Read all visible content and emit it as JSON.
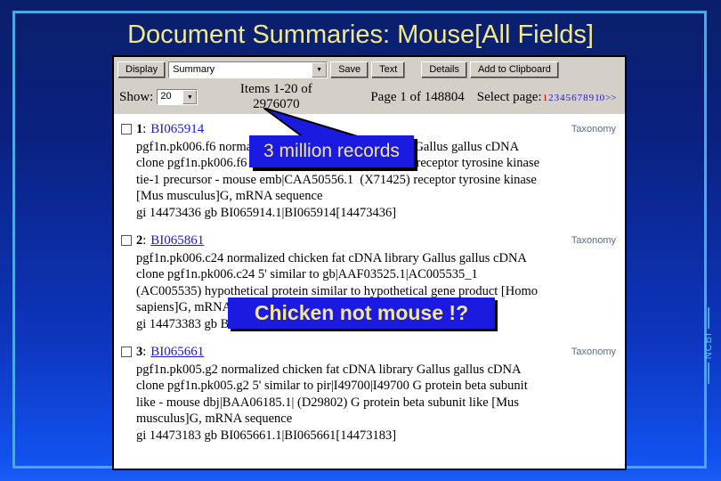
{
  "slide": {
    "title": "Document Summaries: Mouse[All Fields]",
    "brand_tag": "NCBI",
    "colors": {
      "background_top": "#0a1f6b",
      "background_bottom": "#1a5cf5",
      "frame": "#4aa8e8",
      "title_text": "#f2e98a",
      "callout_fill": "#1a1ae0",
      "callout_text": "#f2e79a",
      "link": "#1a1ad0",
      "current_page": "#cc0000"
    }
  },
  "toolbar": {
    "display_label": "Display",
    "display_value": "Summary",
    "save_label": "Save",
    "text_label": "Text",
    "details_label": "Details",
    "clipboard_label": "Add to Clipboard",
    "dropdown_arrow": "▼"
  },
  "pager": {
    "show_label": "Show:",
    "show_value": "20",
    "items_line1": "Items 1-20 of",
    "items_line2": "2976070",
    "page_of": "Page 1 of 148804",
    "select_page_label": "Select page:",
    "pages": [
      "1",
      "2",
      "3",
      "4",
      "5",
      "6",
      "7",
      "8",
      "9",
      "10",
      ">>"
    ],
    "current_page_index": 0
  },
  "records": [
    {
      "number": "1",
      "separator": ":",
      "accession": "BI065914",
      "linked": false,
      "taxonomy_label": "Taxonomy",
      "body": "pgf1n.pk006.f6 normalized chicken fat cDNA library Gallus gallus cDNA\nclone pgf1n.pk006.f6 5' similar to pir|S57847|S57847 receptor tyrosine kinase\ntie-1 precursor - mouse emb|CAA50556.1  (X71425) receptor tyrosine kinase\n[Mus musculus]G, mRNA sequence\ngi 14473436 gb BI065914.1|BI065914[14473436]"
    },
    {
      "number": "2",
      "separator": ":",
      "accession": "BI065861",
      "linked": true,
      "taxonomy_label": "Taxonomy",
      "body": "pgf1n.pk006.c24 normalized chicken fat cDNA library Gallus gallus cDNA\nclone pgf1n.pk006.c24 5' similar to gb|AAF03525.1|AC005535_1\n(AC005535) hypothetical protein similar to hypothetical gene product [Homo\nsapiens]G, mRNA sequence\ngi 14473383 gb BI065861.1|BI065861[14473383]"
    },
    {
      "number": "3",
      "separator": ":",
      "accession": "BI065661",
      "linked": true,
      "taxonomy_label": "Taxonomy",
      "body": "pgf1n.pk005.g2 normalized chicken fat cDNA library Gallus gallus cDNA\nclone pgf1n.pk005.g2 5' similar to pir|I49700|I49700 G protein beta subunit\nlike - mouse dbj|BAA06185.1| (D29802) G protein beta subunit like [Mus\nmusculus]G, mRNA sequence\ngi 14473183 gb BI065661.1|BI065661[14473183]"
    }
  ],
  "callouts": {
    "records": "3 million records",
    "chicken": "Chicken not mouse !?"
  }
}
